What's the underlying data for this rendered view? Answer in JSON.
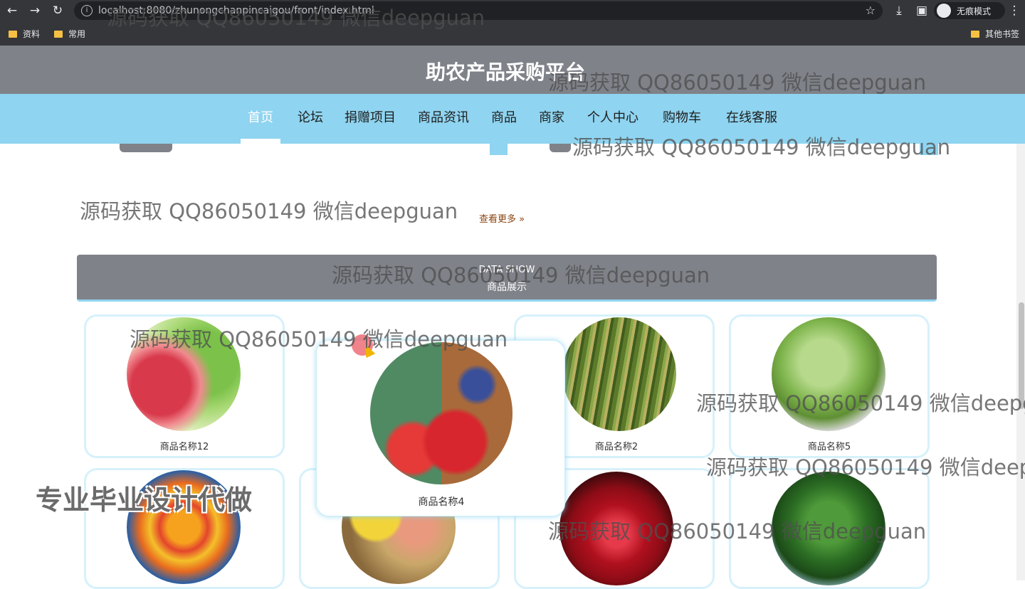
{
  "browser": {
    "url": "localhost:8080/zhunongchanpincaigou/front/index.html",
    "incognito_label": "无痕模式",
    "bookmarks": [
      "资料",
      "常用"
    ],
    "other_bookmarks": "其他书签"
  },
  "site": {
    "title": "助农产品采购平台",
    "nav": [
      "首页",
      "论坛",
      "捐赠项目",
      "商品资讯",
      "商品",
      "商家",
      "个人中心",
      "购物车",
      "在线客服"
    ],
    "active_nav": "首页"
  },
  "news": {
    "more_label": "查看更多 »"
  },
  "section": {
    "title_en": "DATA SHOW",
    "title_cn": "商品展示"
  },
  "products": [
    {
      "name": "商品名称12",
      "image": "peach"
    },
    {
      "name": "商品名称4",
      "image": "berries"
    },
    {
      "name": "商品名称2",
      "image": "millet"
    },
    {
      "name": "商品名称5",
      "image": "cabbage"
    },
    {
      "name": "",
      "image": "peppers"
    },
    {
      "name": "",
      "image": "fruit-basket"
    },
    {
      "name": "",
      "image": "pomegranate"
    },
    {
      "name": "",
      "image": "spinach"
    }
  ],
  "watermarks": {
    "text": "源码获取 QQ86050149 微信deepguan",
    "promo": "专业毕业设计代做"
  },
  "colors": {
    "header_gray": "#7f8289",
    "nav_blue": "#8fd4f0"
  }
}
